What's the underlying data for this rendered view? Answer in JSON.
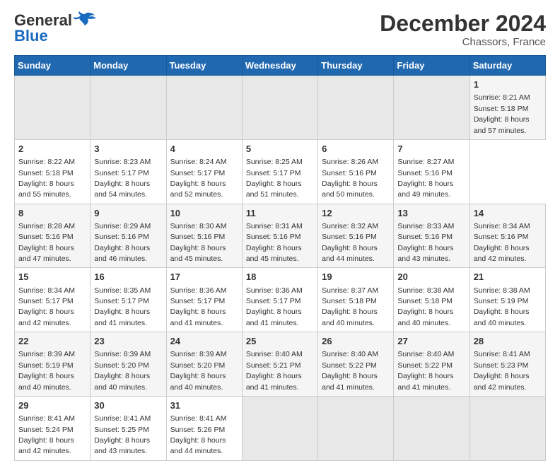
{
  "logo": {
    "text_general": "General",
    "text_blue": "Blue"
  },
  "header": {
    "title": "December 2024",
    "subtitle": "Chassors, France"
  },
  "calendar": {
    "headers": [
      "Sunday",
      "Monday",
      "Tuesday",
      "Wednesday",
      "Thursday",
      "Friday",
      "Saturday"
    ],
    "weeks": [
      [
        {
          "num": "",
          "empty": true
        },
        {
          "num": "",
          "empty": true
        },
        {
          "num": "",
          "empty": true
        },
        {
          "num": "",
          "empty": true
        },
        {
          "num": "",
          "empty": true
        },
        {
          "num": "",
          "empty": true
        },
        {
          "num": "1",
          "sunrise": "Sunrise: 8:21 AM",
          "sunset": "Sunset: 5:18 PM",
          "daylight": "Daylight: 8 hours and 57 minutes."
        }
      ],
      [
        {
          "num": "2",
          "sunrise": "Sunrise: 8:22 AM",
          "sunset": "Sunset: 5:18 PM",
          "daylight": "Daylight: 8 hours and 55 minutes."
        },
        {
          "num": "3",
          "sunrise": "Sunrise: 8:23 AM",
          "sunset": "Sunset: 5:17 PM",
          "daylight": "Daylight: 8 hours and 54 minutes."
        },
        {
          "num": "4",
          "sunrise": "Sunrise: 8:24 AM",
          "sunset": "Sunset: 5:17 PM",
          "daylight": "Daylight: 8 hours and 52 minutes."
        },
        {
          "num": "5",
          "sunrise": "Sunrise: 8:25 AM",
          "sunset": "Sunset: 5:17 PM",
          "daylight": "Daylight: 8 hours and 51 minutes."
        },
        {
          "num": "6",
          "sunrise": "Sunrise: 8:26 AM",
          "sunset": "Sunset: 5:16 PM",
          "daylight": "Daylight: 8 hours and 50 minutes."
        },
        {
          "num": "7",
          "sunrise": "Sunrise: 8:27 AM",
          "sunset": "Sunset: 5:16 PM",
          "daylight": "Daylight: 8 hours and 49 minutes."
        }
      ],
      [
        {
          "num": "8",
          "sunrise": "Sunrise: 8:28 AM",
          "sunset": "Sunset: 5:16 PM",
          "daylight": "Daylight: 8 hours and 47 minutes."
        },
        {
          "num": "9",
          "sunrise": "Sunrise: 8:29 AM",
          "sunset": "Sunset: 5:16 PM",
          "daylight": "Daylight: 8 hours and 46 minutes."
        },
        {
          "num": "10",
          "sunrise": "Sunrise: 8:30 AM",
          "sunset": "Sunset: 5:16 PM",
          "daylight": "Daylight: 8 hours and 45 minutes."
        },
        {
          "num": "11",
          "sunrise": "Sunrise: 8:31 AM",
          "sunset": "Sunset: 5:16 PM",
          "daylight": "Daylight: 8 hours and 45 minutes."
        },
        {
          "num": "12",
          "sunrise": "Sunrise: 8:32 AM",
          "sunset": "Sunset: 5:16 PM",
          "daylight": "Daylight: 8 hours and 44 minutes."
        },
        {
          "num": "13",
          "sunrise": "Sunrise: 8:33 AM",
          "sunset": "Sunset: 5:16 PM",
          "daylight": "Daylight: 8 hours and 43 minutes."
        },
        {
          "num": "14",
          "sunrise": "Sunrise: 8:34 AM",
          "sunset": "Sunset: 5:16 PM",
          "daylight": "Daylight: 8 hours and 42 minutes."
        }
      ],
      [
        {
          "num": "15",
          "sunrise": "Sunrise: 8:34 AM",
          "sunset": "Sunset: 5:17 PM",
          "daylight": "Daylight: 8 hours and 42 minutes."
        },
        {
          "num": "16",
          "sunrise": "Sunrise: 8:35 AM",
          "sunset": "Sunset: 5:17 PM",
          "daylight": "Daylight: 8 hours and 41 minutes."
        },
        {
          "num": "17",
          "sunrise": "Sunrise: 8:36 AM",
          "sunset": "Sunset: 5:17 PM",
          "daylight": "Daylight: 8 hours and 41 minutes."
        },
        {
          "num": "18",
          "sunrise": "Sunrise: 8:36 AM",
          "sunset": "Sunset: 5:17 PM",
          "daylight": "Daylight: 8 hours and 41 minutes."
        },
        {
          "num": "19",
          "sunrise": "Sunrise: 8:37 AM",
          "sunset": "Sunset: 5:18 PM",
          "daylight": "Daylight: 8 hours and 40 minutes."
        },
        {
          "num": "20",
          "sunrise": "Sunrise: 8:38 AM",
          "sunset": "Sunset: 5:18 PM",
          "daylight": "Daylight: 8 hours and 40 minutes."
        },
        {
          "num": "21",
          "sunrise": "Sunrise: 8:38 AM",
          "sunset": "Sunset: 5:19 PM",
          "daylight": "Daylight: 8 hours and 40 minutes."
        }
      ],
      [
        {
          "num": "22",
          "sunrise": "Sunrise: 8:39 AM",
          "sunset": "Sunset: 5:19 PM",
          "daylight": "Daylight: 8 hours and 40 minutes."
        },
        {
          "num": "23",
          "sunrise": "Sunrise: 8:39 AM",
          "sunset": "Sunset: 5:20 PM",
          "daylight": "Daylight: 8 hours and 40 minutes."
        },
        {
          "num": "24",
          "sunrise": "Sunrise: 8:39 AM",
          "sunset": "Sunset: 5:20 PM",
          "daylight": "Daylight: 8 hours and 40 minutes."
        },
        {
          "num": "25",
          "sunrise": "Sunrise: 8:40 AM",
          "sunset": "Sunset: 5:21 PM",
          "daylight": "Daylight: 8 hours and 41 minutes."
        },
        {
          "num": "26",
          "sunrise": "Sunrise: 8:40 AM",
          "sunset": "Sunset: 5:22 PM",
          "daylight": "Daylight: 8 hours and 41 minutes."
        },
        {
          "num": "27",
          "sunrise": "Sunrise: 8:40 AM",
          "sunset": "Sunset: 5:22 PM",
          "daylight": "Daylight: 8 hours and 41 minutes."
        },
        {
          "num": "28",
          "sunrise": "Sunrise: 8:41 AM",
          "sunset": "Sunset: 5:23 PM",
          "daylight": "Daylight: 8 hours and 42 minutes."
        }
      ],
      [
        {
          "num": "29",
          "sunrise": "Sunrise: 8:41 AM",
          "sunset": "Sunset: 5:24 PM",
          "daylight": "Daylight: 8 hours and 42 minutes."
        },
        {
          "num": "30",
          "sunrise": "Sunrise: 8:41 AM",
          "sunset": "Sunset: 5:25 PM",
          "daylight": "Daylight: 8 hours and 43 minutes."
        },
        {
          "num": "31",
          "sunrise": "Sunrise: 8:41 AM",
          "sunset": "Sunset: 5:26 PM",
          "daylight": "Daylight: 8 hours and 44 minutes."
        },
        {
          "num": "",
          "empty": true
        },
        {
          "num": "",
          "empty": true
        },
        {
          "num": "",
          "empty": true
        },
        {
          "num": "",
          "empty": true
        }
      ]
    ]
  }
}
